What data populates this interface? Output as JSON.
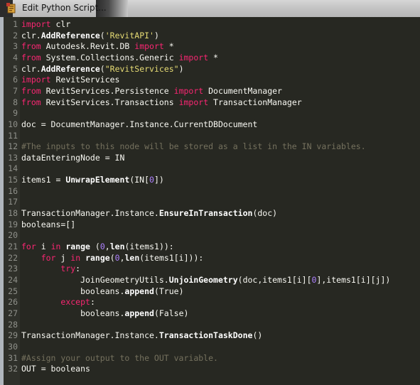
{
  "window": {
    "title": "Edit Python Script..."
  },
  "editor": {
    "colors": {
      "background": "#272822",
      "keyword": "#f92672",
      "string": "#e6db74",
      "number": "#ae81ff",
      "comment": "#75715e",
      "text": "#f8f8f2",
      "line_number": "#8f908a"
    },
    "lines": [
      {
        "n": "1",
        "t": [
          [
            "kw",
            "import"
          ],
          [
            "id",
            " clr"
          ]
        ]
      },
      {
        "n": "2",
        "t": [
          [
            "id",
            "clr."
          ],
          [
            "fn",
            "AddReference"
          ],
          [
            "id",
            "("
          ],
          [
            "st",
            "'RevitAPI'"
          ],
          [
            "id",
            ")"
          ]
        ]
      },
      {
        "n": "3",
        "t": [
          [
            "kw",
            "from"
          ],
          [
            "id",
            " Autodesk.Revit.DB "
          ],
          [
            "kw",
            "import"
          ],
          [
            "id",
            " *"
          ]
        ]
      },
      {
        "n": "4",
        "t": [
          [
            "kw",
            "from"
          ],
          [
            "id",
            " System.Collections.Generic "
          ],
          [
            "kw",
            "import"
          ],
          [
            "id",
            " *"
          ]
        ]
      },
      {
        "n": "5",
        "t": [
          [
            "id",
            "clr."
          ],
          [
            "fn",
            "AddReference"
          ],
          [
            "id",
            "("
          ],
          [
            "st",
            "\"RevitServices\""
          ],
          [
            "id",
            ")"
          ]
        ]
      },
      {
        "n": "6",
        "t": [
          [
            "kw",
            "import"
          ],
          [
            "id",
            " RevitServices"
          ]
        ]
      },
      {
        "n": "7",
        "t": [
          [
            "kw",
            "from"
          ],
          [
            "id",
            " RevitServices.Persistence "
          ],
          [
            "kw",
            "import"
          ],
          [
            "id",
            " DocumentManager"
          ]
        ]
      },
      {
        "n": "8",
        "t": [
          [
            "kw",
            "from"
          ],
          [
            "id",
            " RevitServices.Transactions "
          ],
          [
            "kw",
            "import"
          ],
          [
            "id",
            " TransactionManager"
          ]
        ]
      },
      {
        "n": "9",
        "t": []
      },
      {
        "n": "10",
        "t": [
          [
            "id",
            "doc = DocumentManager.Instance.CurrentDBDocument"
          ]
        ]
      },
      {
        "n": "11",
        "t": []
      },
      {
        "n": "12",
        "t": [
          [
            "cm",
            "#The inputs to this node will be stored as a list in the IN variables."
          ]
        ]
      },
      {
        "n": "13",
        "t": [
          [
            "id",
            "dataEnteringNode = IN"
          ]
        ]
      },
      {
        "n": "14",
        "t": []
      },
      {
        "n": "15",
        "t": [
          [
            "id",
            "items1 = "
          ],
          [
            "fn",
            "UnwrapElement"
          ],
          [
            "id",
            "(IN["
          ],
          [
            "nm",
            "0"
          ],
          [
            "id",
            "])"
          ]
        ]
      },
      {
        "n": "16",
        "t": []
      },
      {
        "n": "17",
        "t": []
      },
      {
        "n": "18",
        "t": [
          [
            "id",
            "TransactionManager.Instance."
          ],
          [
            "fn",
            "EnsureInTransaction"
          ],
          [
            "id",
            "(doc)"
          ]
        ]
      },
      {
        "n": "19",
        "t": [
          [
            "id",
            "booleans=[]"
          ]
        ]
      },
      {
        "n": "20",
        "t": []
      },
      {
        "n": "21",
        "t": [
          [
            "kw",
            "for"
          ],
          [
            "id",
            " i "
          ],
          [
            "kw",
            "in"
          ],
          [
            "id",
            " "
          ],
          [
            "fn",
            "range"
          ],
          [
            "id",
            " ("
          ],
          [
            "nm",
            "0"
          ],
          [
            "id",
            ","
          ],
          [
            "fn",
            "len"
          ],
          [
            "id",
            "(items1)):"
          ]
        ]
      },
      {
        "n": "22",
        "t": [
          [
            "id",
            "    "
          ],
          [
            "kw",
            "for"
          ],
          [
            "id",
            " j "
          ],
          [
            "kw",
            "in"
          ],
          [
            "id",
            " "
          ],
          [
            "fn",
            "range"
          ],
          [
            "id",
            "("
          ],
          [
            "nm",
            "0"
          ],
          [
            "id",
            ","
          ],
          [
            "fn",
            "len"
          ],
          [
            "id",
            "(items1[i])):"
          ]
        ]
      },
      {
        "n": "23",
        "t": [
          [
            "id",
            "        "
          ],
          [
            "kw",
            "try"
          ],
          [
            "id",
            ":"
          ]
        ]
      },
      {
        "n": "24",
        "t": [
          [
            "id",
            "            JoinGeometryUtils."
          ],
          [
            "fn",
            "UnjoinGeometry"
          ],
          [
            "id",
            "(doc,items1[i]["
          ],
          [
            "nm",
            "0"
          ],
          [
            "id",
            "],items1[i][j])"
          ]
        ]
      },
      {
        "n": "25",
        "t": [
          [
            "id",
            "            booleans."
          ],
          [
            "fn",
            "append"
          ],
          [
            "id",
            "(True)"
          ]
        ]
      },
      {
        "n": "26",
        "t": [
          [
            "id",
            "        "
          ],
          [
            "kw",
            "except"
          ],
          [
            "id",
            ":"
          ]
        ]
      },
      {
        "n": "27",
        "t": [
          [
            "id",
            "            booleans."
          ],
          [
            "fn",
            "append"
          ],
          [
            "id",
            "(False)"
          ]
        ]
      },
      {
        "n": "28",
        "t": []
      },
      {
        "n": "29",
        "t": [
          [
            "id",
            "TransactionManager.Instance."
          ],
          [
            "fn",
            "TransactionTaskDone"
          ],
          [
            "id",
            "()"
          ]
        ]
      },
      {
        "n": "30",
        "t": []
      },
      {
        "n": "31",
        "t": [
          [
            "cm",
            "#Assign your output to the OUT variable."
          ]
        ]
      },
      {
        "n": "32",
        "t": [
          [
            "id",
            "OUT = booleans"
          ]
        ]
      }
    ]
  }
}
